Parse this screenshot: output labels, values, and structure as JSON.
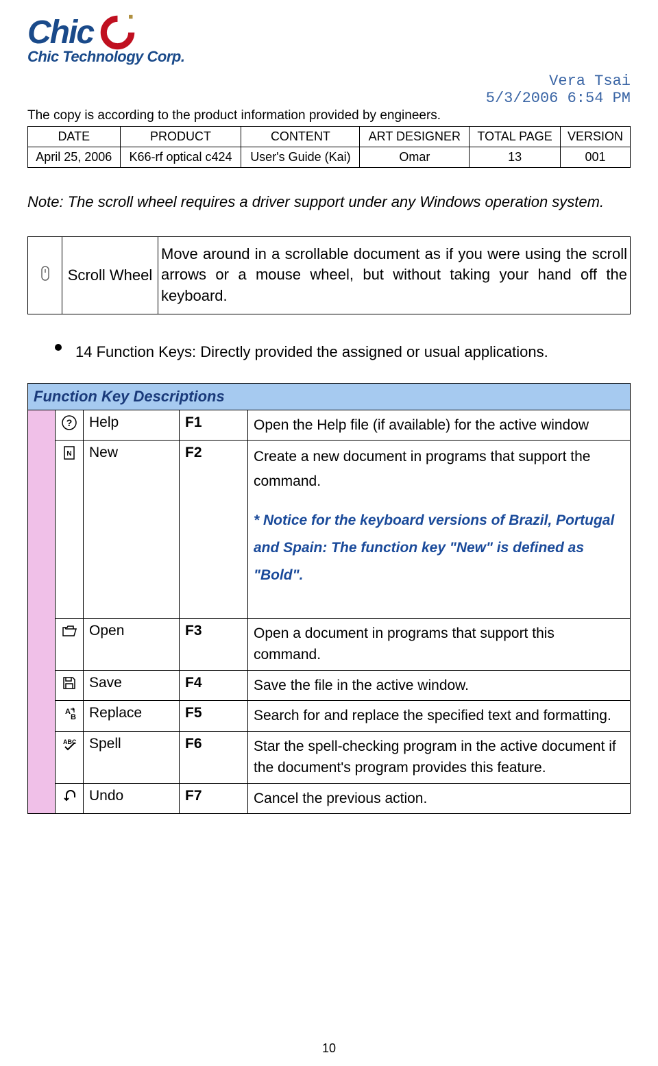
{
  "logo": {
    "brand": "Chic",
    "subtitle": "Chic Technology Corp."
  },
  "meta": {
    "author": "Vera Tsai",
    "datetime": "5/3/2006 6:54 PM"
  },
  "copy_note": "The copy is according to the product information provided by engineers.",
  "info_table": {
    "headers": [
      "DATE",
      "PRODUCT",
      "CONTENT",
      "ART DESIGNER",
      "TOTAL PAGE",
      "VERSION"
    ],
    "row": [
      "April 25, 2006",
      "K66-rf optical c424",
      "User's Guide (Kai)",
      "Omar",
      "13",
      "001"
    ]
  },
  "note": "Note: The scroll wheel requires a driver support under any Windows operation system.",
  "scroll": {
    "name": "Scroll Wheel",
    "desc": "Move around in a scrollable document as if you were using the scroll arrows or a mouse wheel, but without taking your hand off the keyboard."
  },
  "bullet": "14 Function Keys: Directly provided the assigned or usual applications.",
  "func_header": "Function Key Descriptions",
  "func_rows": [
    {
      "icon": "help",
      "name": "Help",
      "key": "F1",
      "desc": "Open the Help file (if available) for the active window"
    },
    {
      "icon": "new",
      "name": "New",
      "key": "F2",
      "desc": "Create a new document in programs that support the command.",
      "notice": "* Notice for the keyboard versions of Brazil, Portugal and Spain: The function key \"New\" is defined as \"Bold\"."
    },
    {
      "icon": "open",
      "name": "Open",
      "key": "F3",
      "desc": "Open a document in programs that support this command."
    },
    {
      "icon": "save",
      "name": "Save",
      "key": "F4",
      "desc": "Save the file in the active window."
    },
    {
      "icon": "replace",
      "name": "Replace",
      "key": "F5",
      "desc": "Search for and replace the specified text and formatting."
    },
    {
      "icon": "spell",
      "name": "Spell",
      "key": "F6",
      "desc": "Star the spell-checking program in the active document if the document's program provides this feature."
    },
    {
      "icon": "undo",
      "name": "Undo",
      "key": "F7",
      "desc": "Cancel the previous action."
    }
  ],
  "page_number": "10"
}
